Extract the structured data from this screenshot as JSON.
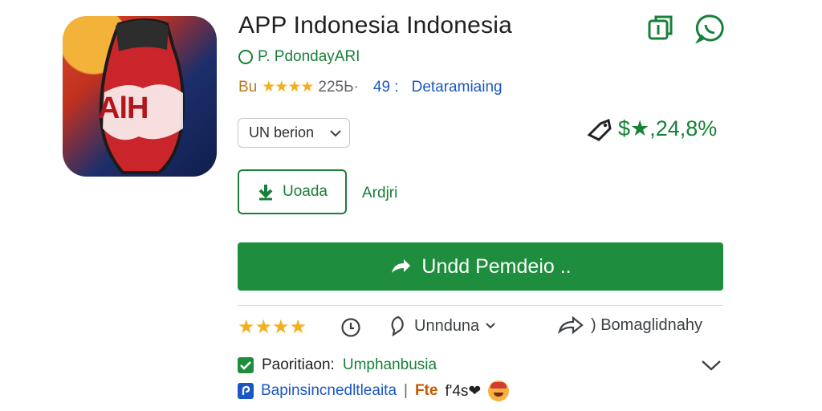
{
  "app": {
    "title": "APP Indonesia  Indonesia",
    "developer": "P. PdondayARI",
    "rating_lead": "Bu",
    "rating_stars": "★★★★",
    "rating_count": "225Ь·",
    "rating_number": "49 :",
    "category": "Detaramiaing"
  },
  "icon": {
    "text": "AlH"
  },
  "version_select": {
    "value": "UN berion"
  },
  "price": {
    "value": "$★,24,8%"
  },
  "actions": {
    "download_label": "Uoada",
    "secondary_label": "Ardjri",
    "main_label": "Undd Pemdeio .."
  },
  "bottom": {
    "stars": "★★★★",
    "comment_label": "Unnduna",
    "share_label": ") Bomaglidnahy"
  },
  "permissions": {
    "label": "Paoritiaon:",
    "value": "Umphanbusia"
  },
  "info": {
    "text": "Bapinsincnedltleaita",
    "separator": "|",
    "brand": "Fte",
    "misc": "f'4s❤"
  },
  "colors": {
    "primary": "#1e8e3e",
    "link": "#1a57c5",
    "star": "#f2b01e"
  }
}
